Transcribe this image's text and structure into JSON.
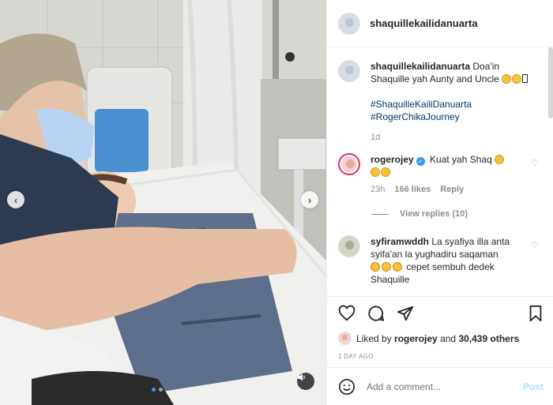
{
  "post": {
    "username": "shaquillekailidanuarta"
  },
  "caption": {
    "username": "shaquillekailidanuarta",
    "text_line1": "Doa'in",
    "text_line2": "Shaquille yah Aunty and Uncle",
    "hashtags": [
      "#ShaquilleKailiDanuarta",
      "#RogerChikaJourney"
    ],
    "age": "1d"
  },
  "comments": [
    {
      "username": "rogerojey",
      "verified": true,
      "text": "Kuat yah Shaq",
      "time": "23h",
      "likes": "166 likes",
      "reply": "Reply",
      "view_replies": "View replies (10)"
    },
    {
      "username": "syfiramwddh",
      "text_line1": "La syafiya illa anta",
      "text_line2": "syifa'an la yughadiru saqaman",
      "text_line3": "cepet sembuh dedek",
      "text_line4": "Shaquille"
    }
  ],
  "actions": {
    "liked_prefix": "Liked by",
    "liked_user": "rogerojey",
    "liked_and": "and",
    "liked_others": "30,439 others",
    "date": "1 DAY AGO"
  },
  "comment_box": {
    "placeholder": "Add a comment...",
    "post_label": "Post"
  },
  "carousel": {
    "slides": 2,
    "active": 0
  },
  "colors": {
    "accent": "#3897f0",
    "hashtag": "#00376b",
    "muted": "#8e8e8e",
    "post_disabled": "#b2dffc"
  },
  "icons": [
    "heart-icon",
    "comment-icon",
    "share-icon",
    "bookmark-icon",
    "smiley-icon",
    "audio-icon",
    "chevron-left-icon",
    "chevron-right-icon",
    "verified-icon"
  ]
}
